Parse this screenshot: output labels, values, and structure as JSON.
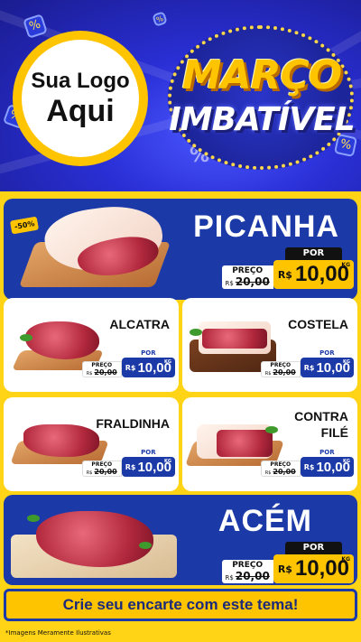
{
  "header": {
    "logo_line1": "Sua Logo",
    "logo_line2": "Aqui",
    "title_line1": "MARÇO",
    "title_line2": "IMBATÍVEL"
  },
  "colors": {
    "brand_blue": "#1b3aa8",
    "brand_yellow": "#ffc400",
    "panel_yellow": "#ffd316"
  },
  "products": [
    {
      "name": "PICANHA",
      "discount": "-50%",
      "old_label": "PREÇO",
      "currency": "R$",
      "old_price": "20,00",
      "por": "POR",
      "price": "10,00",
      "unit": "KG"
    },
    {
      "name": "ALCATRA",
      "old_label": "PREÇO",
      "currency": "R$",
      "old_price": "20,00",
      "por": "POR",
      "price": "10,00",
      "unit": "KG"
    },
    {
      "name": "COSTELA",
      "old_label": "PREÇO",
      "currency": "R$",
      "old_price": "20,00",
      "por": "POR",
      "price": "10,00",
      "unit": "KG"
    },
    {
      "name": "FRALDINHA",
      "old_label": "PREÇO",
      "currency": "R$",
      "old_price": "20,00",
      "por": "POR",
      "price": "10,00",
      "unit": "KG"
    },
    {
      "name_line1": "CONTRA",
      "name_line2": "FILÉ",
      "old_label": "PREÇO",
      "currency": "R$",
      "old_price": "20,00",
      "por": "POR",
      "price": "10,00",
      "unit": "KG"
    },
    {
      "name": "ACÉM",
      "old_label": "PREÇO",
      "currency": "R$",
      "old_price": "20,00",
      "por": "POR",
      "price": "10,00",
      "unit": "KG"
    }
  ],
  "banner": "Crie seu encarte com este tema!",
  "footnote": "*Imagens Meramente Ilustrativas"
}
